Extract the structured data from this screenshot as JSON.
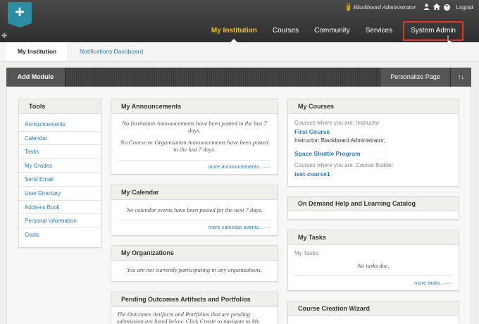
{
  "header": {
    "user_name": "Blackboard Administrator",
    "logout_label": "Logout",
    "nav": [
      "My Institution",
      "Courses",
      "Community",
      "Services",
      "System Admin"
    ]
  },
  "subnav": {
    "current": "My Institution",
    "link": "Notifications Dashboard"
  },
  "modbar": {
    "add_module": "Add Module",
    "personalize": "Personalize Page"
  },
  "tools": {
    "title": "Tools",
    "items": [
      "Announcements",
      "Calendar",
      "Tasks",
      "My Grades",
      "Send Email",
      "User Directory",
      "Address Book",
      "Personal Information",
      "Goals"
    ]
  },
  "announcements": {
    "title": "My Announcements",
    "msg1": "No Institution Announcements have been posted in the last 7 days.",
    "msg2": "No Course or Organization Announcements have been posted in the last 7 days.",
    "more": "more announcements..."
  },
  "calendar": {
    "title": "My Calendar",
    "msg": "No calendar events have been posted for the next 7 days.",
    "more": "more calendar events..."
  },
  "organizations": {
    "title": "My Organizations",
    "msg": "You are not currently participating in any organizations."
  },
  "outcomes": {
    "title": "Pending Outcomes Artifacts and Portfolios",
    "msg": "The Outcomes Artifacts and Portfolios that are pending submission are listed below. Click Create to navigate to My"
  },
  "courses": {
    "title": "My Courses",
    "instructor_label": "Courses where you are: Instructor",
    "course1": "First Course",
    "course1_instructor": "Instructor: Blackboard Administrator;",
    "course2": "Space Shuttle Program",
    "builder_label": "Courses where you are: Course Builder",
    "course3": "test-course1"
  },
  "ondemand": {
    "title": "On Demand Help and Learning Catalog"
  },
  "tasks": {
    "title": "My Tasks",
    "label": "My Tasks:",
    "msg": "No tasks due.",
    "more": "more tasks..."
  },
  "wizard": {
    "title": "Course Creation Wizard"
  },
  "colors": {
    "accent": "#f2c21a",
    "link": "#2b7bb9",
    "highlight": "#e0392b"
  }
}
